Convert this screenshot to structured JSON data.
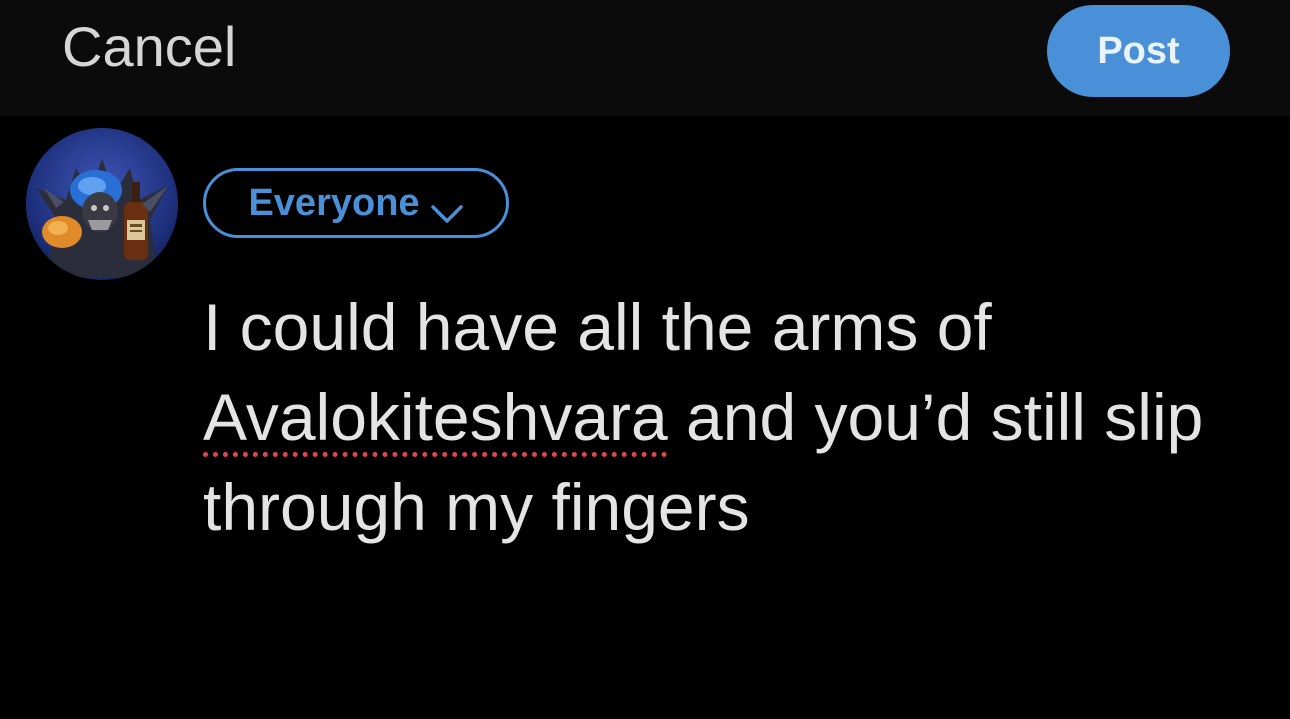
{
  "header": {
    "cancel_label": "Cancel",
    "post_label": "Post"
  },
  "composer": {
    "audience_label": "Everyone",
    "text_before": "I could have all the arms of ",
    "misspelled_word": "Avalokiteshvara",
    "text_after": " and you’d still slip through my fingers"
  },
  "colors": {
    "accent": "#4a90d9",
    "background": "#000000",
    "text": "#e4e4e4",
    "spellcheck": "#e0474c"
  },
  "icons": {
    "audience_chevron": "chevron-down-icon"
  }
}
